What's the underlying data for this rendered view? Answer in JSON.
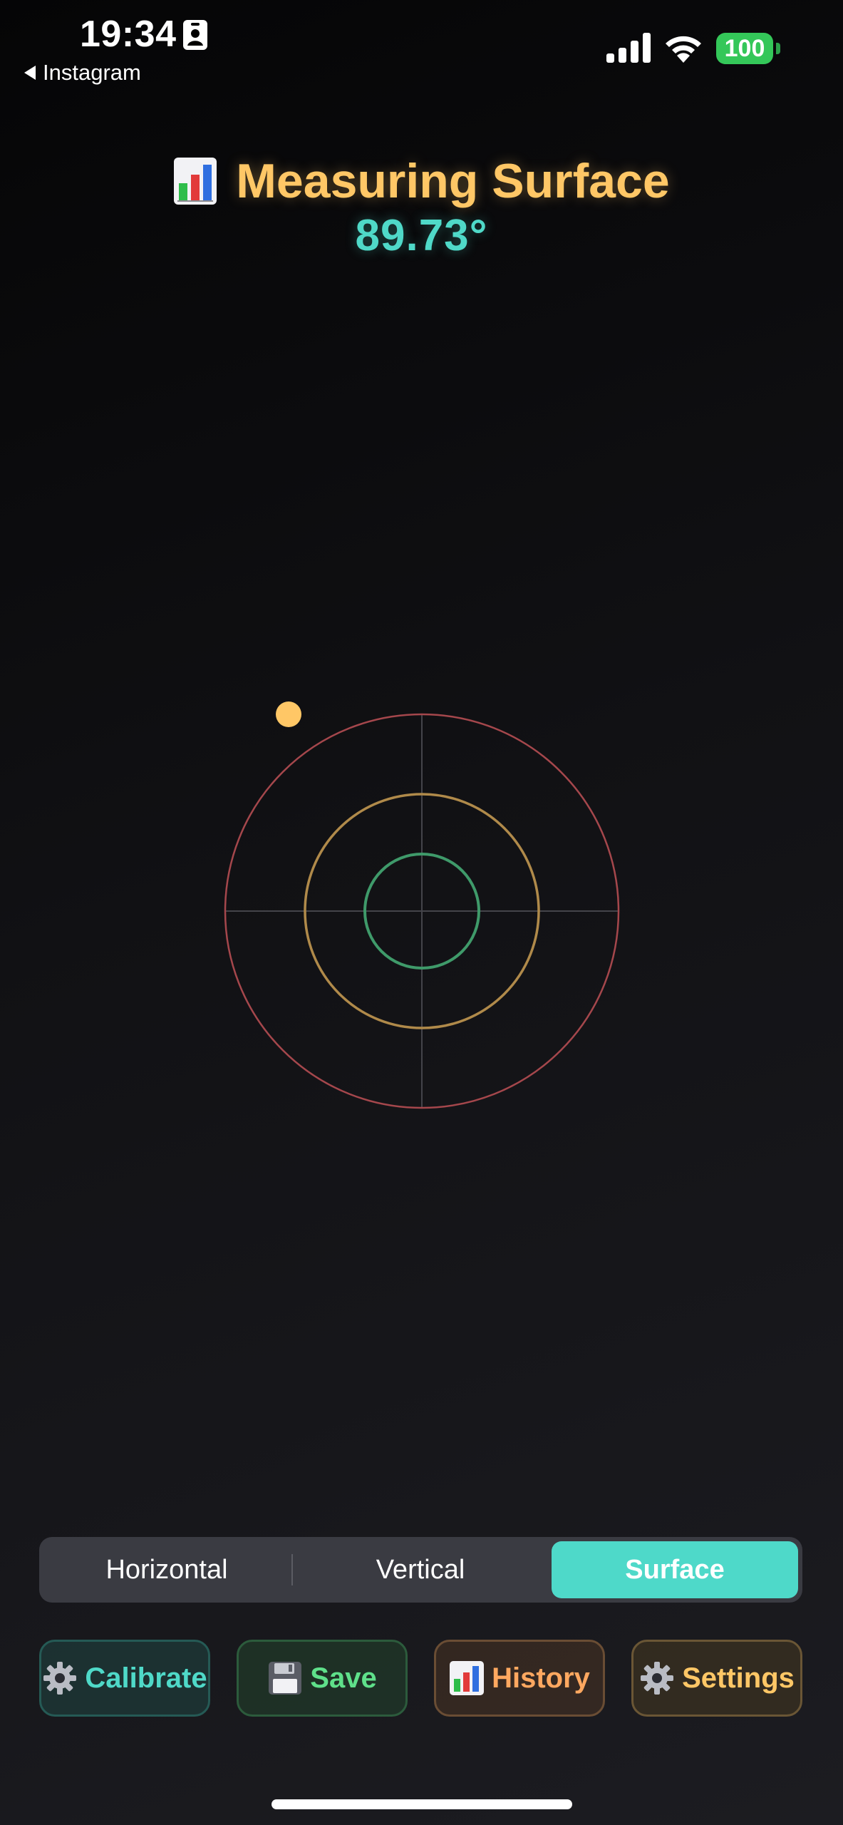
{
  "status_bar": {
    "time": "19:34",
    "back_app": "Instagram",
    "battery": "100",
    "icons": [
      "id-badge-icon",
      "back-arrow-icon",
      "signal-icon",
      "wifi-icon",
      "battery-icon"
    ]
  },
  "header": {
    "icon": "chart-emoji-icon",
    "title": "Measuring Surface",
    "angle": "89.73°"
  },
  "level": {
    "rings": [
      "outer-ring",
      "middle-ring",
      "inner-ring"
    ],
    "colors": {
      "outer_ring": "#a5474c",
      "middle_ring": "#b08a4a",
      "inner_ring": "#3f9a6a",
      "crosshair": "#4a4a50",
      "bubble": "#ffc766"
    }
  },
  "mode_selector": {
    "options": [
      "Horizontal",
      "Vertical",
      "Surface"
    ],
    "selected": "Surface"
  },
  "actions": {
    "calibrate": {
      "label": "Calibrate",
      "icon": "gear-icon"
    },
    "save": {
      "label": "Save",
      "icon": "floppy-disk-icon"
    },
    "history": {
      "label": "History",
      "icon": "chart-emoji-icon"
    },
    "settings": {
      "label": "Settings",
      "icon": "gear-icon"
    }
  },
  "theme": {
    "accent_teal": "#4ed9c9",
    "accent_gold": "#ffc766",
    "accent_green": "#5fe08a",
    "accent_orange": "#ffa860",
    "battery_green": "#34c759"
  }
}
